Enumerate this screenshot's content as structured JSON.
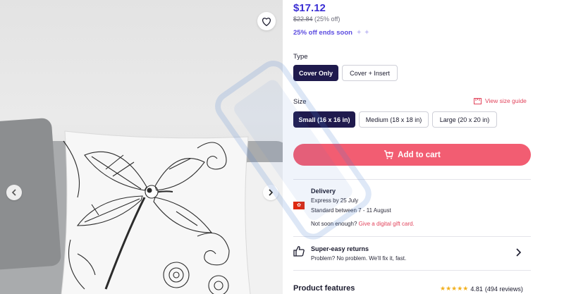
{
  "product": {
    "price": "$17.12",
    "old_price": "$22.84",
    "discount": "(25% off)",
    "promo": "25% off ends soon"
  },
  "type": {
    "label": "Type",
    "options": [
      "Cover Only",
      "Cover + Insert"
    ],
    "selected": "Cover Only"
  },
  "size": {
    "label": "Size",
    "guide_link": "View size guide",
    "options": [
      "Small (16 x 16 in)",
      "Medium (18 x 18 in)",
      "Large (20 x 20 in)"
    ],
    "selected": "Small (16 x 16 in)"
  },
  "cart": {
    "button_label": "Add to cart"
  },
  "delivery": {
    "title": "Delivery",
    "express": "Express by 25 July",
    "standard": "Standard between 7 - 11 August",
    "not_soon": "Not soon enough?",
    "gift_link": "Give a digital gift card."
  },
  "returns": {
    "title": "Super-easy returns",
    "subtitle": "Problem? No problem. We'll fix it, fast."
  },
  "features": {
    "title": "Product features",
    "rating_value": "4.81",
    "rating_count": "(494 reviews)",
    "stars": "★★★★★"
  },
  "icons": {
    "heart": "heart-icon",
    "chevron_left": "chevron-left-icon",
    "chevron_right": "chevron-right-icon",
    "cart": "cart-icon",
    "ruler": "ruler-icon",
    "flag": "hong-kong-flag-icon",
    "thumbs_up": "thumbs-up-icon"
  },
  "colors": {
    "price": "#3b2fd4",
    "selected_option": "#1f1a4d",
    "add_to_cart": "#f25d72",
    "link": "#e2445c",
    "stars": "#f2b01e"
  }
}
